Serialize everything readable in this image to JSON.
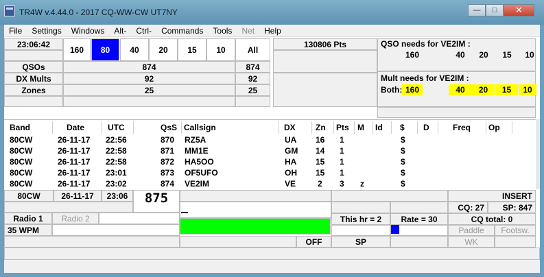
{
  "window": {
    "title": "TR4W v.4.44.0 - 2017 CQ-WW-CW UT7NY"
  },
  "menu": [
    "File",
    "Settings",
    "Windows",
    "Alt-",
    "Ctrl-",
    "Commands",
    "Tools",
    "Net",
    "Help"
  ],
  "menu_disabled": [
    "Net"
  ],
  "clock": "23:06:42",
  "bands": [
    "160",
    "80",
    "40",
    "20",
    "15",
    "10",
    "All"
  ],
  "selected_band": "80",
  "stats": [
    {
      "label": "QSOs",
      "band": "874",
      "all": "874"
    },
    {
      "label": "DX Mults",
      "band": "92",
      "all": "92"
    },
    {
      "label": "Zones",
      "band": "25",
      "all": "25"
    }
  ],
  "points": "130806 Pts",
  "qso_needs": {
    "title": "QSO needs for VE2IM :",
    "values": [
      "160",
      "40",
      "20",
      "15",
      "10"
    ]
  },
  "mult_needs": {
    "title": "Mult needs for VE2IM :",
    "prefix": "Both:",
    "values": [
      "160",
      "40",
      "20",
      "15",
      "10"
    ],
    "highlight_color": "#ffff00"
  },
  "log_columns": [
    "Band",
    "Date",
    "UTC",
    "QsS",
    "Callsign",
    "DX",
    "Zn",
    "Pts",
    "M",
    "Id",
    "$",
    "D",
    "Freq",
    "Op"
  ],
  "log_rows": [
    {
      "band": "80CW",
      "date": "26-11-17",
      "utc": "22:56",
      "qso": "870",
      "call": "RZ5A",
      "dx": "UA",
      "zn": "16",
      "pts": "1",
      "m": "",
      "dollar": "$"
    },
    {
      "band": "80CW",
      "date": "26-11-17",
      "utc": "22:58",
      "qso": "871",
      "call": "MM1E",
      "dx": "GM",
      "zn": "14",
      "pts": "1",
      "m": "",
      "dollar": "$"
    },
    {
      "band": "80CW",
      "date": "26-11-17",
      "utc": "22:58",
      "qso": "872",
      "call": "HA5OO",
      "dx": "HA",
      "zn": "15",
      "pts": "1",
      "m": "",
      "dollar": "$"
    },
    {
      "band": "80CW",
      "date": "26-11-17",
      "utc": "23:01",
      "qso": "873",
      "call": "OF5UFO",
      "dx": "OH",
      "zn": "15",
      "pts": "1",
      "m": "",
      "dollar": "$"
    },
    {
      "band": "80CW",
      "date": "26-11-17",
      "utc": "23:02",
      "qso": "874",
      "call": "VE2IM",
      "dx": "VE",
      "zn": "2",
      "pts": "3",
      "m": "z",
      "dollar": "$"
    }
  ],
  "entry": {
    "band": "80CW",
    "date": "26-11-17",
    "utc": "23:06",
    "qso_number": "875",
    "mode": "INSERT"
  },
  "counters": {
    "cq": "CQ: 27",
    "sp": "SP: 847",
    "this_hr": "This hr = 2",
    "rate": "Rate = 30",
    "cq_total": "CQ total: 0"
  },
  "radio": {
    "radio1": "Radio 1",
    "radio2": "Radio 2",
    "wpm": "35 WPM"
  },
  "keys": {
    "paddle": "Paddle",
    "footsw": "Footsw.",
    "off": "OFF",
    "sp": "SP",
    "wk": "WK"
  }
}
